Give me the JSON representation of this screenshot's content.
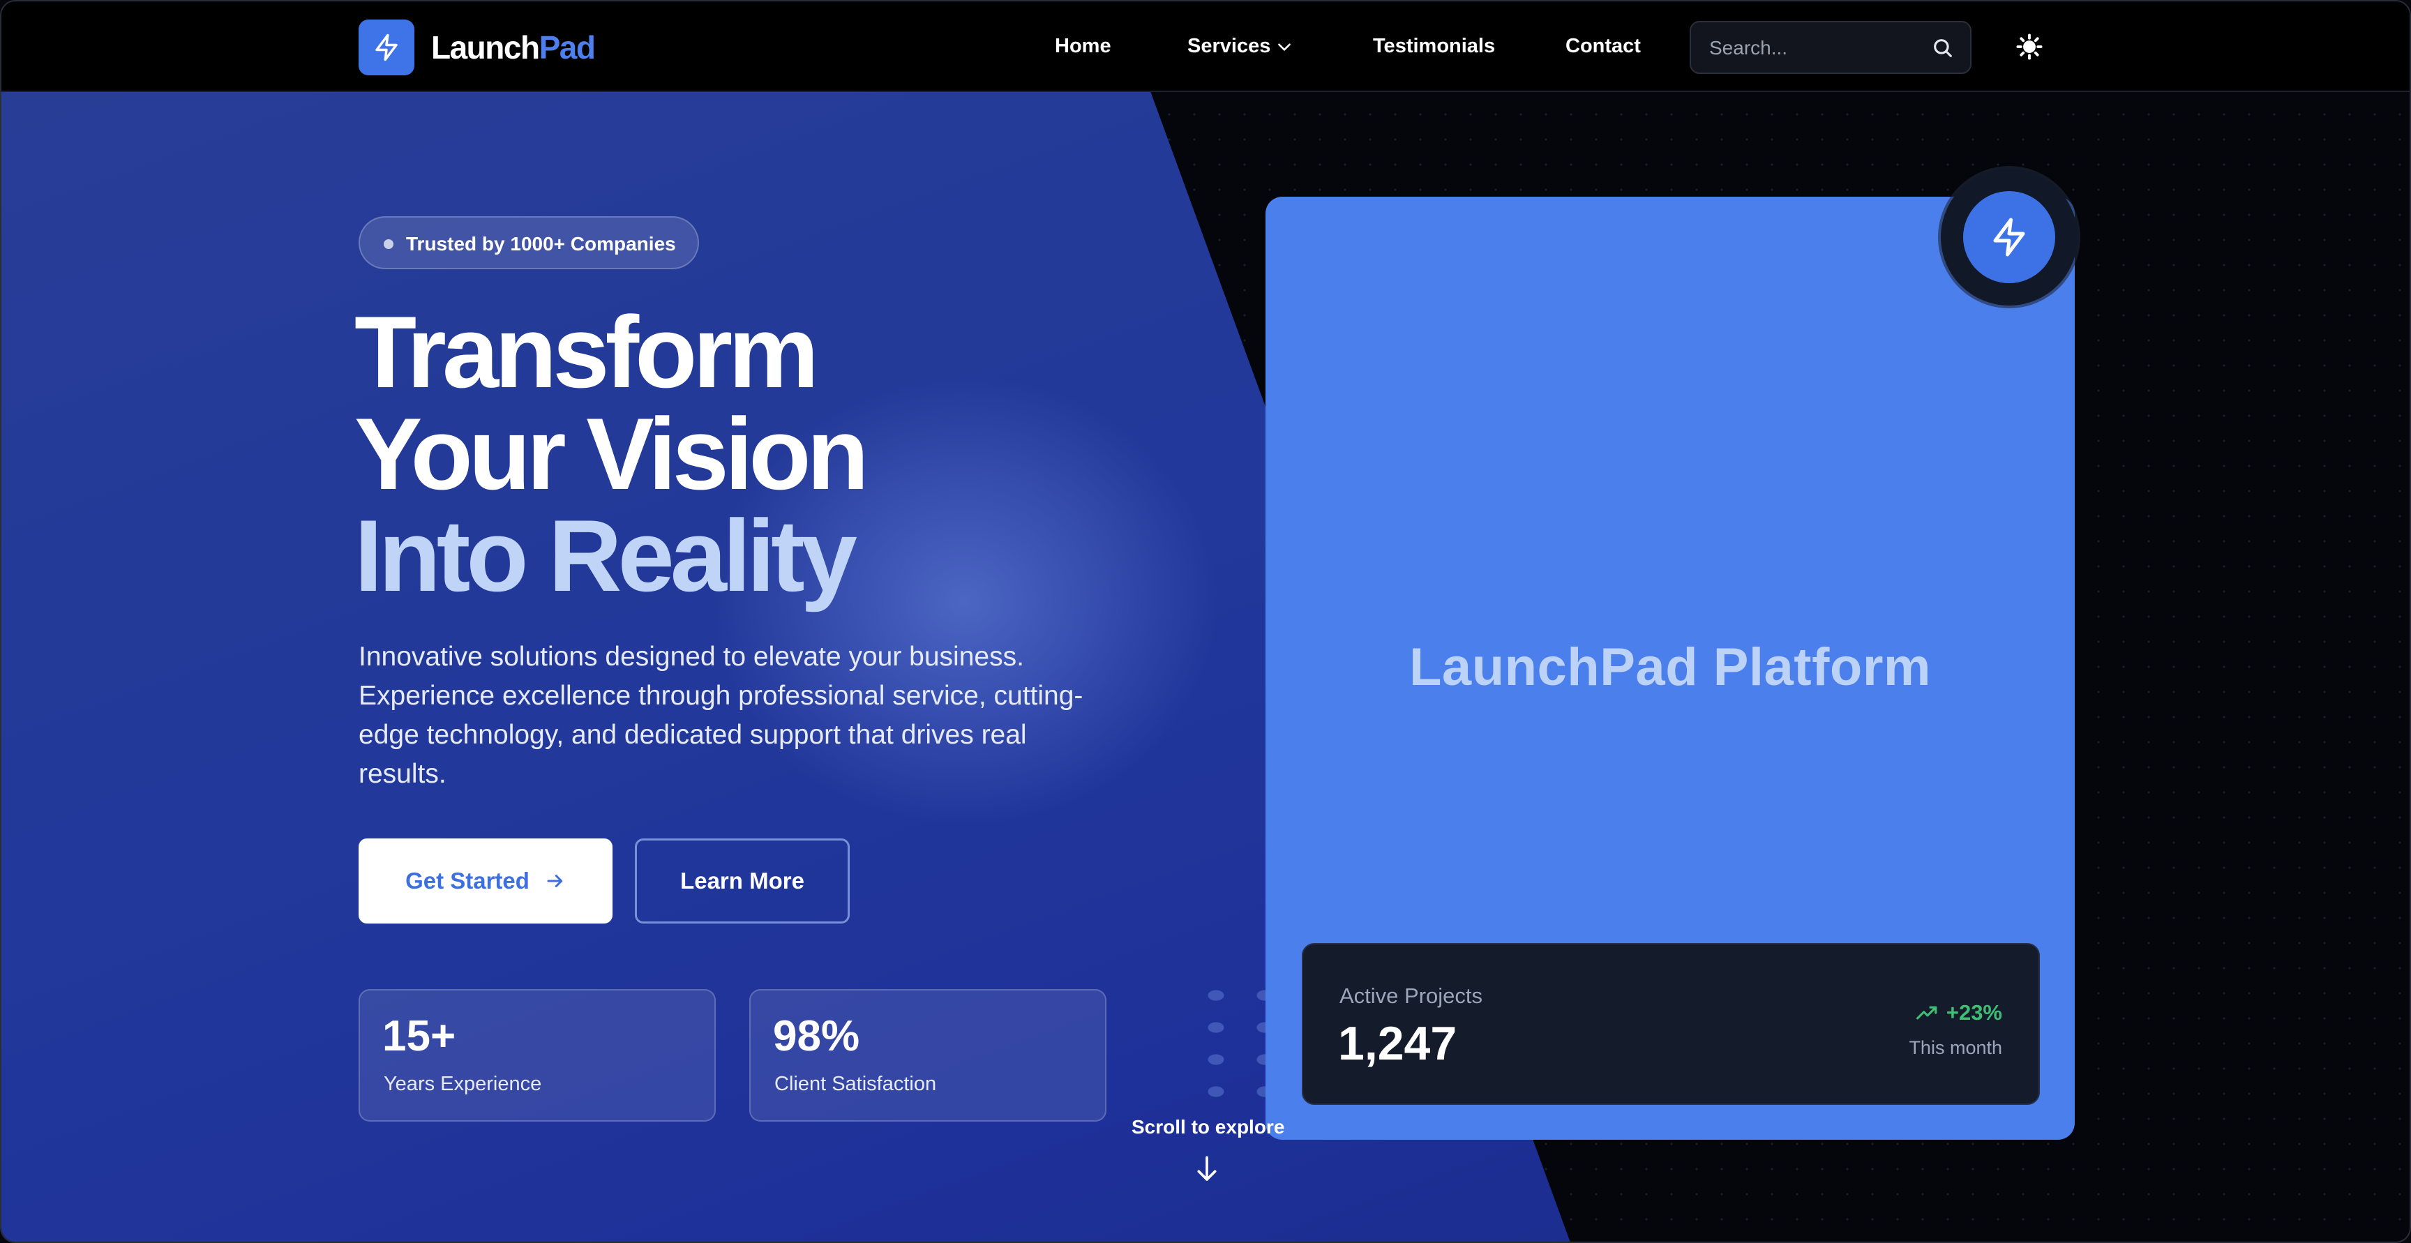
{
  "brand": {
    "name_part1": "Launch",
    "name_part2": "Pad",
    "logo_icon": "lightning-bolt-icon"
  },
  "nav": {
    "items": [
      {
        "label": "Home"
      },
      {
        "label": "Services",
        "has_dropdown": true
      },
      {
        "label": "Testimonials"
      },
      {
        "label": "Contact"
      }
    ],
    "search_placeholder": "Search...",
    "search_icon": "search-icon",
    "theme_toggle_icon": "sun-icon"
  },
  "hero": {
    "badge": "Trusted by 1000+ Companies",
    "headline": [
      "Transform",
      "Your Vision",
      "Into Reality"
    ],
    "subtext": "Innovative solutions designed to elevate your business. Experience excellence through professional service, cutting-edge technology, and dedicated support that drives real results.",
    "primary_button": "Get Started",
    "secondary_button": "Learn More",
    "stats": [
      {
        "value": "15+",
        "label": "Years Experience"
      },
      {
        "value": "98%",
        "label": "Client Satisfaction"
      }
    ],
    "scroll_hint": "Scroll to explore"
  },
  "card": {
    "title": "LaunchPad Platform",
    "metric_label": "Active Projects",
    "metric_value": "1,247",
    "metric_change": "+23%",
    "metric_period": "This month"
  },
  "colors": {
    "accent": "#4a7fec",
    "brand_blue": "#3f74e8",
    "hero_blue": "#22389a",
    "positive": "#3fbf73",
    "header_bg": "#000000"
  }
}
